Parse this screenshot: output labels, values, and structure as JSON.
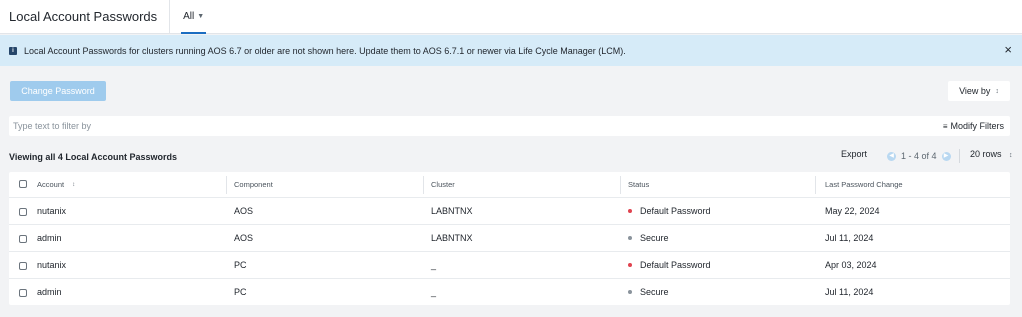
{
  "header": {
    "title": "Local Account Passwords",
    "tab_label": "All"
  },
  "banner": {
    "message": "Local Account Passwords for clusters running AOS 6.7 or older are not shown here. Update them to AOS 6.7.1 or newer via Life Cycle Manager (LCM).",
    "icon": "info-icon",
    "close_icon": "close-icon",
    "close_glyph": "×"
  },
  "toolbar": {
    "change_password_label": "Change Password",
    "view_by_label": "View by"
  },
  "filter": {
    "placeholder": "Type text to filter by",
    "modify_filters_label": "Modify Filters"
  },
  "summary": {
    "text": "Viewing all 4 Local Account Passwords",
    "export_label": "Export",
    "page_range": "1 - 4 of 4",
    "rows_label": "20 rows"
  },
  "table": {
    "columns": [
      "Account",
      "Component",
      "Cluster",
      "Status",
      "Last Password Change"
    ],
    "rows": [
      {
        "account": "nutanix",
        "component": "AOS",
        "cluster": "LABNTNX",
        "status": "Default Password",
        "last_change": "May 22, 2024"
      },
      {
        "account": "admin",
        "component": "AOS",
        "cluster": "LABNTNX",
        "status": "Secure",
        "last_change": "Jul 11, 2024"
      },
      {
        "account": "nutanix",
        "component": "PC",
        "cluster": "_",
        "status": "Default Password",
        "last_change": "Apr 03, 2024"
      },
      {
        "account": "admin",
        "component": "PC",
        "cluster": "_",
        "status": "Secure",
        "last_change": "Jul 11, 2024"
      }
    ]
  },
  "colors": {
    "default_password": "#e0434f",
    "secure": "#8a939c",
    "accent": "#1b6dc1",
    "banner_bg": "#d6ebf8"
  }
}
